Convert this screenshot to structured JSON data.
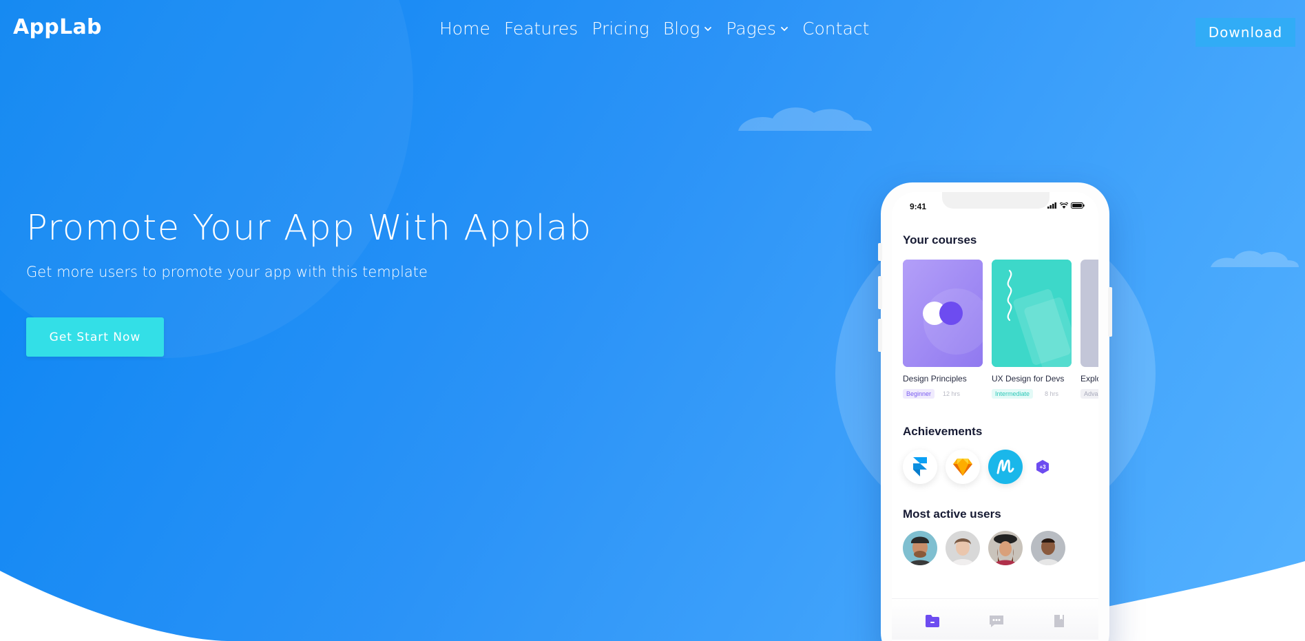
{
  "brand": {
    "logo": "AppLab"
  },
  "nav": {
    "items": [
      {
        "label": "Home",
        "dropdown": false
      },
      {
        "label": "Features",
        "dropdown": false
      },
      {
        "label": "Pricing",
        "dropdown": false
      },
      {
        "label": "Blog",
        "dropdown": true
      },
      {
        "label": "Pages",
        "dropdown": true
      },
      {
        "label": "Contact",
        "dropdown": false
      }
    ],
    "download_label": "Download"
  },
  "hero": {
    "title": "Promote Your App With Applab",
    "subtitle": "Get more users to promote your app with this template",
    "cta_label": "Get Start Now"
  },
  "phone": {
    "time": "9:41",
    "courses_title": "Your courses",
    "courses": [
      {
        "name": "Design Principles",
        "level": "Beginner",
        "hours": "12 hrs"
      },
      {
        "name": "UX Design for Devs",
        "level": "Intermediate",
        "hours": "8 hrs"
      },
      {
        "name": "Explor",
        "level": "Advan",
        "hours": ""
      }
    ],
    "achievements_title": "Achievements",
    "achievements": [
      {
        "icon": "framer-icon"
      },
      {
        "icon": "sketch-icon"
      },
      {
        "icon": "marvel-icon"
      }
    ],
    "achievements_more": "+3",
    "users_title": "Most active users",
    "tabbar": [
      {
        "icon": "folder-icon",
        "active": true
      },
      {
        "icon": "chat-icon",
        "active": false
      },
      {
        "icon": "bookmark-icon",
        "active": false
      }
    ]
  },
  "colors": {
    "hero_gradient_start": "#0a84f2",
    "hero_gradient_end": "#55b2ff",
    "download_button": "#31acf6",
    "cta_button": "#33dfe7",
    "course_purple": "#9d86f5",
    "course_teal": "#3dd8c9",
    "course_gray": "#c3c6d8",
    "accent_purple": "#6d4cf0"
  }
}
